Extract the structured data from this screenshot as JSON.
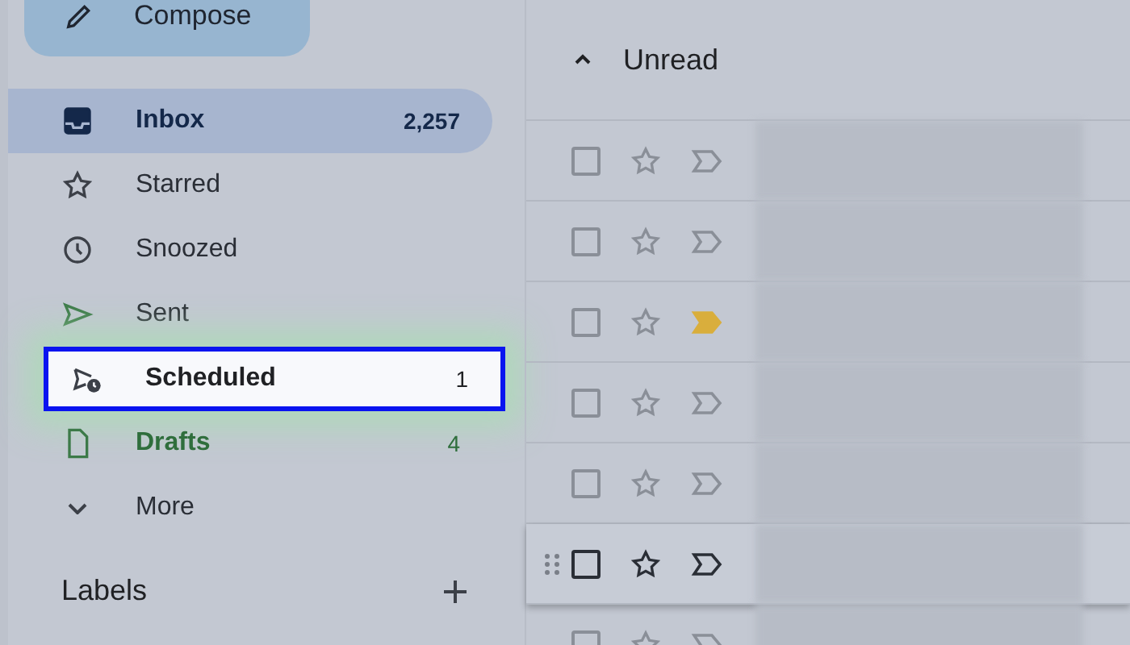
{
  "compose": {
    "label": "Compose"
  },
  "nav": [
    {
      "kind": "inbox",
      "label": "Inbox",
      "count": "2,257",
      "selected": true,
      "highlighted": false
    },
    {
      "kind": "starred",
      "label": "Starred",
      "selected": false,
      "highlighted": false
    },
    {
      "kind": "snoozed",
      "label": "Snoozed",
      "selected": false,
      "highlighted": false
    },
    {
      "kind": "sent",
      "label": "Sent",
      "selected": false,
      "highlighted": false
    },
    {
      "kind": "scheduled",
      "label": "Scheduled",
      "count": "1",
      "selected": false,
      "highlighted": true
    },
    {
      "kind": "drafts",
      "label": "Drafts",
      "count": "4",
      "selected": false,
      "highlighted": false
    },
    {
      "kind": "more",
      "label": "More",
      "selected": false,
      "highlighted": false
    }
  ],
  "labels": {
    "title": "Labels"
  },
  "section": {
    "title": "Unread",
    "expanded": true
  },
  "rows": [
    {
      "checked": false,
      "starred": false,
      "important": false,
      "hovered": false
    },
    {
      "checked": false,
      "starred": false,
      "important": false,
      "hovered": false
    },
    {
      "checked": false,
      "starred": false,
      "important": true,
      "hovered": false
    },
    {
      "checked": false,
      "starred": false,
      "important": false,
      "hovered": false
    },
    {
      "checked": false,
      "starred": false,
      "important": false,
      "hovered": false
    },
    {
      "checked": false,
      "starred": false,
      "important": false,
      "hovered": true
    },
    {
      "checked": false,
      "starred": false,
      "important": false,
      "hovered": false
    }
  ]
}
